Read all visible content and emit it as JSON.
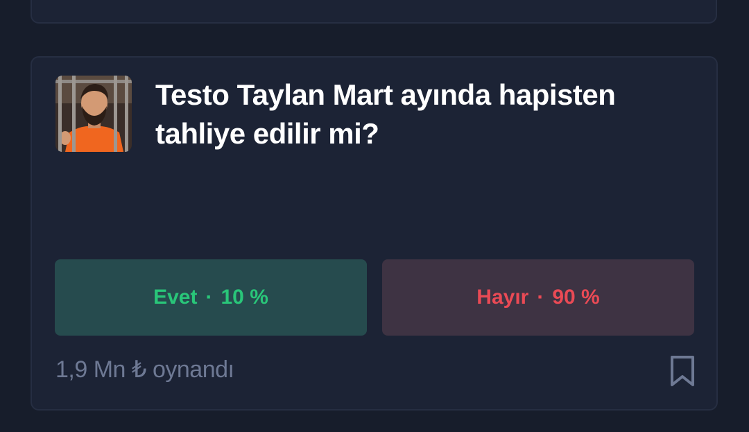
{
  "market": {
    "title": "Testo Taylan Mart ayında hapisten tahliye edilir mi?",
    "volume": "1,9 Mn ₺ oynandı"
  },
  "outcomes": {
    "yes": {
      "label": "Evet",
      "separator": "·",
      "percent": "10 %",
      "color": "#29c679"
    },
    "no": {
      "label": "Hayır",
      "separator": "·",
      "percent": "90 %",
      "color": "#ea4a55"
    }
  },
  "icons": {
    "bookmark": "bookmark-icon"
  }
}
